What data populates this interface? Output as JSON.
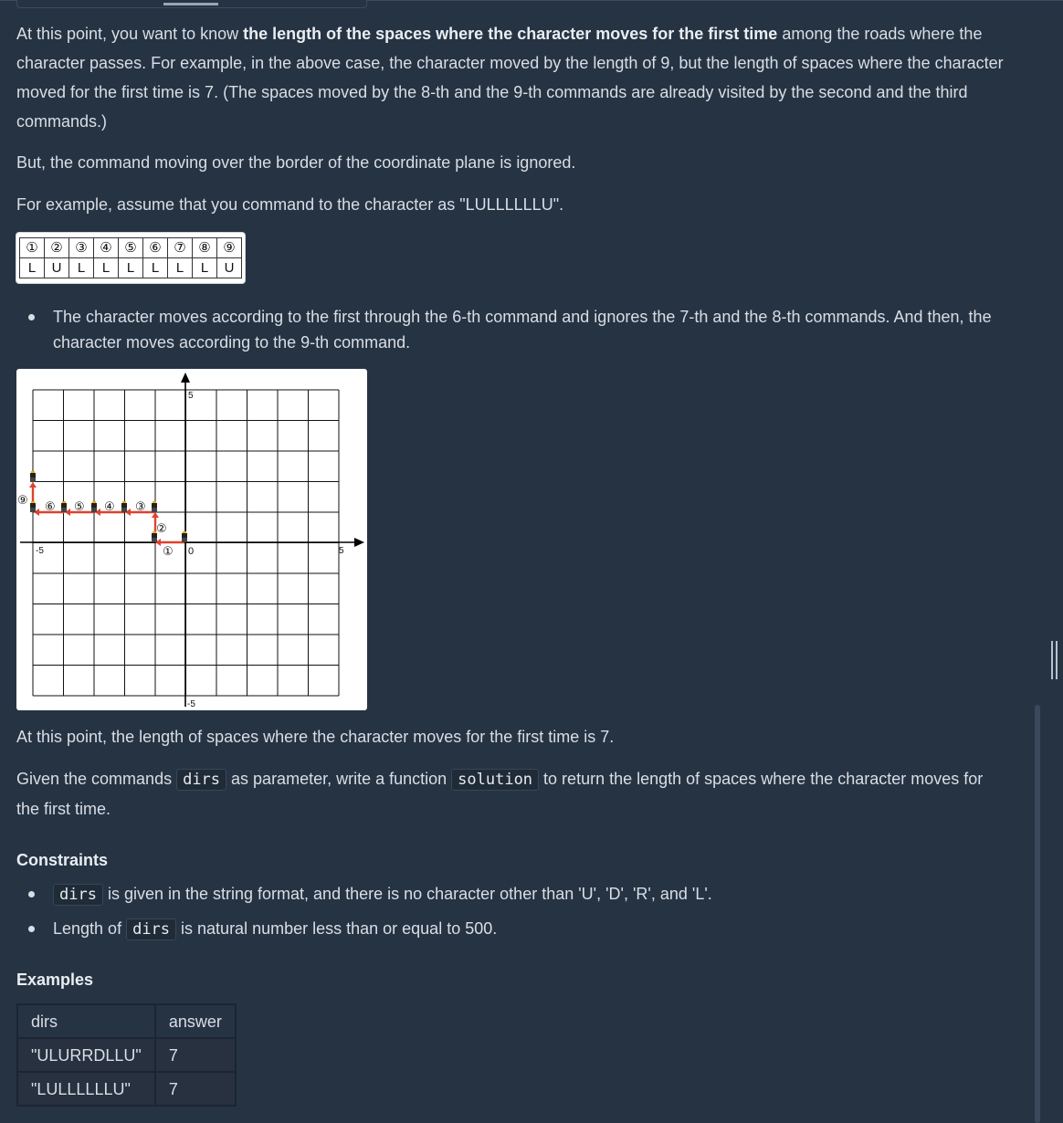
{
  "paragraphs": {
    "p1_before": "At this point, you want to know ",
    "p1_bold": "the length of the spaces where the character moves for the first time",
    "p1_after": " among the roads where the character passes. For example, in the above case, the character moved by the length of 9, but the length of spaces where the character moved for the first time is 7. (The spaces moved by the 8-th and the 9-th commands are already visited by the second and the third commands.)",
    "p2": "But, the command moving over the border of the coordinate plane is ignored.",
    "p3": "For example, assume that you command to the character as \"LULLLLLLU\".",
    "bullet1": "The character moves according to the first through the 6-th command and ignores the 7-th and the 8-th commands. And then, the character moves according to the 9-th command.",
    "p4": "At this point, the length of spaces where the character moves for the first time is 7.",
    "p5_a": "Given the commands ",
    "p5_code1": "dirs",
    "p5_b": " as parameter, write a function ",
    "p5_code2": "solution",
    "p5_c": " to return the length of spaces where the character moves for the first time."
  },
  "command_table": {
    "numbers": [
      "①",
      "②",
      "③",
      "④",
      "⑤",
      "⑥",
      "⑦",
      "⑧",
      "⑨"
    ],
    "commands": [
      "L",
      "U",
      "L",
      "L",
      "L",
      "L",
      "L",
      "L",
      "U"
    ]
  },
  "graph": {
    "tick_labels": {
      "y_top": "5",
      "y_bottom": "-5",
      "x_left": "-5",
      "x_right": "5",
      "origin": "0"
    },
    "step_labels": [
      "①",
      "②",
      "③",
      "④",
      "⑤",
      "⑥",
      "⑨"
    ],
    "path_color": "#e0412e"
  },
  "constraints": {
    "heading": "Constraints",
    "c1_code": "dirs",
    "c1_text": " is given in the string format, and there is no character other than 'U', 'D', 'R', and 'L'.",
    "c2_a": "Length of ",
    "c2_code": "dirs",
    "c2_b": " is natural number less than or equal to 500."
  },
  "examples": {
    "heading": "Examples",
    "columns": [
      "dirs",
      "answer"
    ],
    "rows": [
      [
        "\"ULURRDLLU\"",
        "7"
      ],
      [
        "\"LULLLLLLU\"",
        "7"
      ]
    ]
  }
}
